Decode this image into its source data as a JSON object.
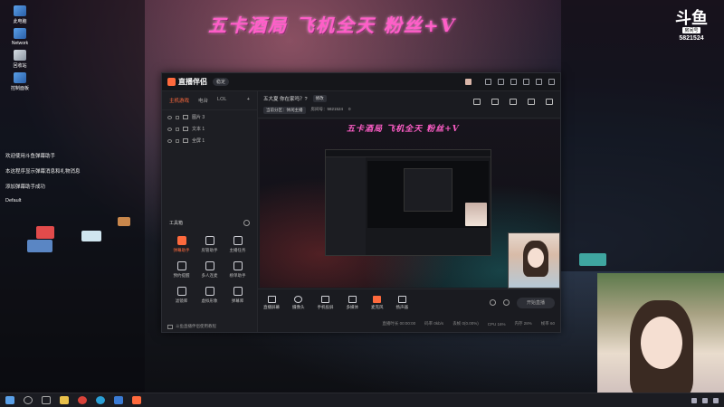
{
  "banner": "五卡酒局 飞机全天 粉丝+V",
  "douyu": {
    "logo": "斗鱼",
    "room_label": "房间号",
    "room_number": "5821524"
  },
  "desktop_icons": [
    {
      "label": "此电脑"
    },
    {
      "label": "Network"
    },
    {
      "label": "回收站"
    },
    {
      "label": "控制面板"
    }
  ],
  "notices": [
    "欢迎使用斗鱼弹幕助手",
    "本这程序显示弹幕消息和礼物消息",
    "添加弹幕助手成功",
    "Default"
  ],
  "app": {
    "title": "直播伴侣",
    "version": "稳定",
    "tabs": [
      "主机游戏",
      "电台",
      "LOL"
    ],
    "add_label": "+",
    "scenes": [
      "图片 3",
      "文本 1",
      "全屏 1"
    ],
    "tools_label": "工具箱",
    "tools": [
      {
        "label": "弹幕助手",
        "hot": true
      },
      {
        "label": "房管助手",
        "hot": false
      },
      {
        "label": "主播任务",
        "hot": false
      },
      {
        "label": "预约提醒",
        "hot": false
      },
      {
        "label": "多人连麦",
        "hot": false
      },
      {
        "label": "榜单助手",
        "hot": false
      },
      {
        "label": "滤镜库",
        "hot": false
      },
      {
        "label": "虚拟形象",
        "hot": false
      },
      {
        "label": "弹幕库",
        "hot": false
      }
    ],
    "left_footer": "斗鱼直播伴侣使用教程",
    "stream_title": "五大夏 你在家吗？?",
    "edit_label": "修改",
    "category": "当前分区：休闲主播",
    "room_info": "房间号：5821524",
    "fans": "0",
    "bottom_buttons": [
      "直播屏幕",
      "摄像头",
      "手机投屏",
      "多媒体",
      "麦克风",
      "扬声器"
    ],
    "start_label": "开始直播",
    "status": [
      "直播时长 00:00:00",
      "码率 0kb/s",
      "丢帧 0(0.00%)",
      "CPU 16%",
      "内存 28%",
      "帧率 60"
    ]
  },
  "taskbar": {
    "icons": [
      "start",
      "search",
      "taskview",
      "explorer",
      "chrome",
      "edge",
      "store",
      "app"
    ]
  }
}
